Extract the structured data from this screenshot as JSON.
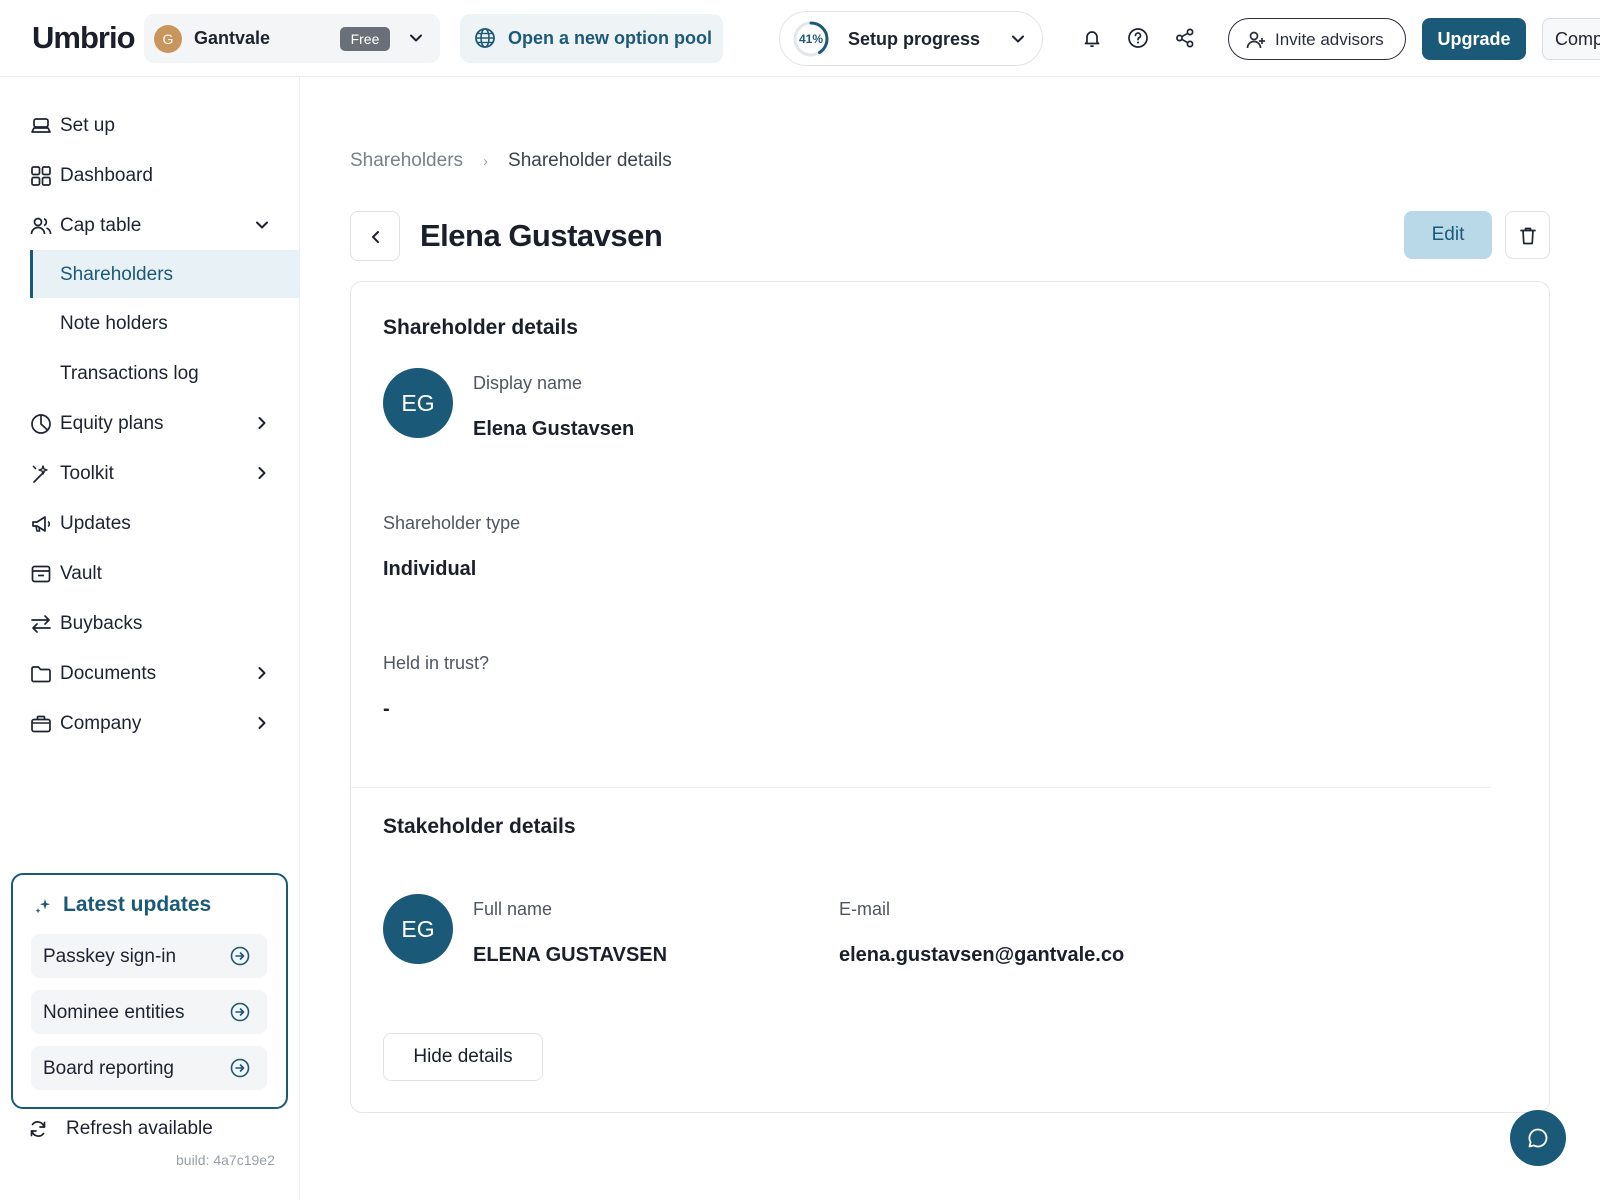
{
  "app": {
    "logo": "Umbrio"
  },
  "topbar": {
    "company": {
      "initial": "G",
      "name": "Gantvale",
      "plan": "Free"
    },
    "option_pool_label": "Open a new option pool",
    "setup": {
      "progress_label": "41%",
      "progress_value": 0.41,
      "label": "Setup progress"
    },
    "invite_label": "Invite advisors",
    "upgrade_label": "Upgrade",
    "company_btn_label": "Comp",
    "accent": "#1a5a78"
  },
  "sidebar": {
    "items": [
      {
        "label": "Set up",
        "icon": "setup-icon"
      },
      {
        "label": "Dashboard",
        "icon": "dashboard-icon"
      },
      {
        "label": "Cap table",
        "icon": "users-icon",
        "expanded": true
      },
      {
        "label": "Shareholders",
        "active": true
      },
      {
        "label": "Note holders"
      },
      {
        "label": "Transactions log"
      },
      {
        "label": "Equity plans",
        "icon": "pie-icon"
      },
      {
        "label": "Toolkit",
        "icon": "wand-icon"
      },
      {
        "label": "Updates",
        "icon": "megaphone-icon"
      },
      {
        "label": "Vault",
        "icon": "vault-icon"
      },
      {
        "label": "Buybacks",
        "icon": "swap-icon"
      },
      {
        "label": "Documents",
        "icon": "folder-icon"
      },
      {
        "label": "Company",
        "icon": "briefcase-icon"
      }
    ],
    "latest_updates": {
      "title": "Latest updates",
      "items": [
        "Passkey sign-in",
        "Nominee entities",
        "Board reporting"
      ]
    },
    "refresh_label": "Refresh available",
    "build": "build: 4a7c19e2"
  },
  "main": {
    "breadcrumb": {
      "parent": "Shareholders",
      "current": "Shareholder details"
    },
    "title": "Elena Gustavsen",
    "edit_label": "Edit",
    "shareholder_details": {
      "title": "Shareholder details",
      "initials": "EG",
      "display_name_label": "Display name",
      "display_name": "Elena Gustavsen",
      "type_label": "Shareholder type",
      "type": "Individual",
      "trust_label": "Held in trust?",
      "trust": "-"
    },
    "stakeholder_details": {
      "title": "Stakeholder details",
      "initials": "EG",
      "full_name_label": "Full name",
      "full_name": "ELENA GUSTAVSEN",
      "email_label": "E-mail",
      "email": "elena.gustavsen@gantvale.co"
    },
    "hide_details_label": "Hide details"
  }
}
